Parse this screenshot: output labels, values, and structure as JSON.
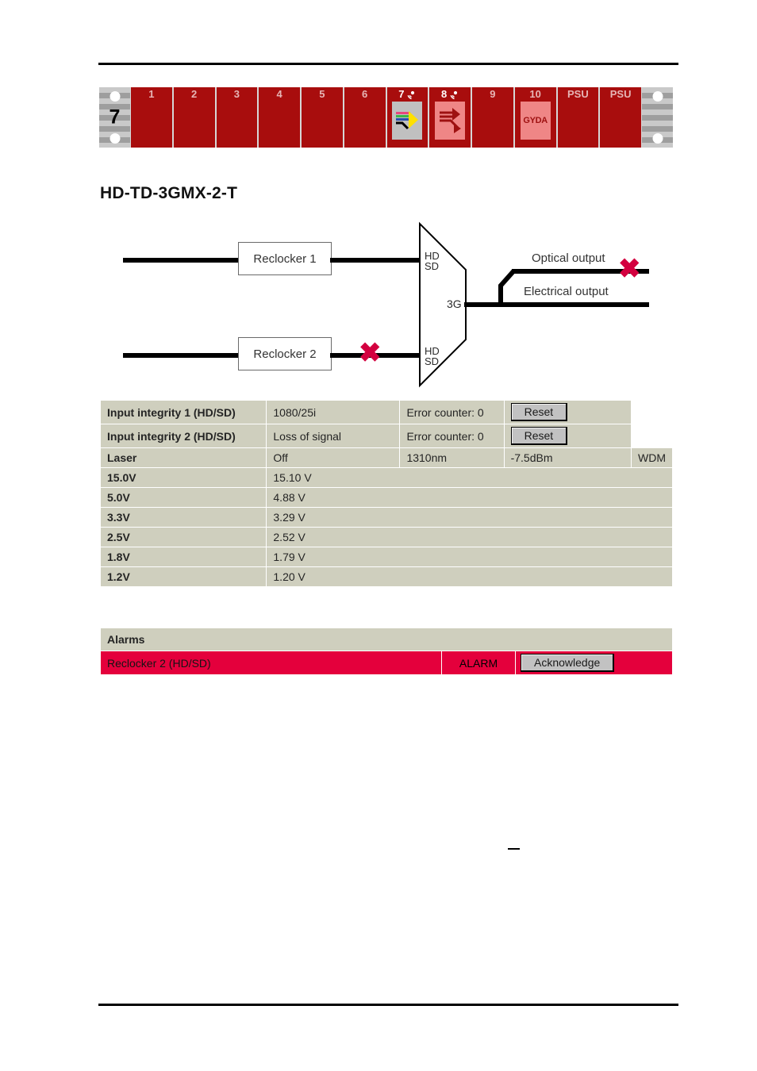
{
  "chassis": {
    "chassis_number": "7",
    "slots": [
      {
        "label": "1",
        "card": "none",
        "active": false,
        "net_icon": false
      },
      {
        "label": "2",
        "card": "none",
        "active": false,
        "net_icon": false
      },
      {
        "label": "3",
        "card": "none",
        "active": false,
        "net_icon": false
      },
      {
        "label": "4",
        "card": "none",
        "active": false,
        "net_icon": false
      },
      {
        "label": "5",
        "card": "none",
        "active": false,
        "net_icon": false
      },
      {
        "label": "6",
        "card": "none",
        "active": false,
        "net_icon": false
      },
      {
        "label": "7",
        "card": "grey",
        "active": true,
        "net_icon": true
      },
      {
        "label": "8",
        "card": "pink",
        "active": true,
        "net_icon": true
      },
      {
        "label": "9",
        "card": "none",
        "active": false,
        "net_icon": false
      },
      {
        "label": "10",
        "card": "gyda",
        "active": false,
        "net_icon": false,
        "card_text": "GYDA"
      },
      {
        "label": "PSU",
        "card": "none",
        "active": false,
        "net_icon": false
      },
      {
        "label": "PSU",
        "card": "none",
        "active": false,
        "net_icon": false
      }
    ],
    "colors": {
      "slot_red": "#a80d0d",
      "rail_grey": "#c9c9c9",
      "card_pink": "#ef8686",
      "card_grey": "#c0c0c0"
    }
  },
  "page": {
    "model_title": "HD-TD-3GMX-2-T"
  },
  "diagram": {
    "reclocker_1": "Reclocker 1",
    "reclocker_2": "Reclocker 2",
    "port_top": "HD\nSD",
    "port_bottom": "HD\nSD",
    "mux_label": "3G",
    "optical_output": "Optical output",
    "electrical_output": "Electrical output",
    "fault_marker": "✖",
    "fault_color": "#d3003f"
  },
  "status": {
    "rows": [
      {
        "key": "Input integrity 1 (HD/SD)",
        "value": "1080/25i",
        "counter": "Error counter: 0",
        "button": "Reset",
        "type": "integrity"
      },
      {
        "key": "Input integrity 2 (HD/SD)",
        "value": "Loss of signal",
        "counter": "Error counter: 0",
        "button": "Reset",
        "type": "integrity"
      },
      {
        "key": "Laser",
        "value": "Off",
        "wavelength": "1310nm",
        "power": "-7.5dBm",
        "mode": "WDM",
        "type": "laser"
      },
      {
        "key": "15.0V",
        "value": "15.10 V",
        "type": "voltage"
      },
      {
        "key": "5.0V",
        "value": "4.88 V",
        "type": "voltage"
      },
      {
        "key": "3.3V",
        "value": "3.29 V",
        "type": "voltage"
      },
      {
        "key": "2.5V",
        "value": "2.52 V",
        "type": "voltage"
      },
      {
        "key": "1.8V",
        "value": "1.79 V",
        "type": "voltage"
      },
      {
        "key": "1.2V",
        "value": "1.20 V",
        "type": "voltage"
      }
    ]
  },
  "alarms": {
    "header": "Alarms",
    "rows": [
      {
        "name": "Reclocker 2 (HD/SD)",
        "state": "ALARM",
        "button": "Acknowledge",
        "color": "#e4003c"
      }
    ]
  }
}
